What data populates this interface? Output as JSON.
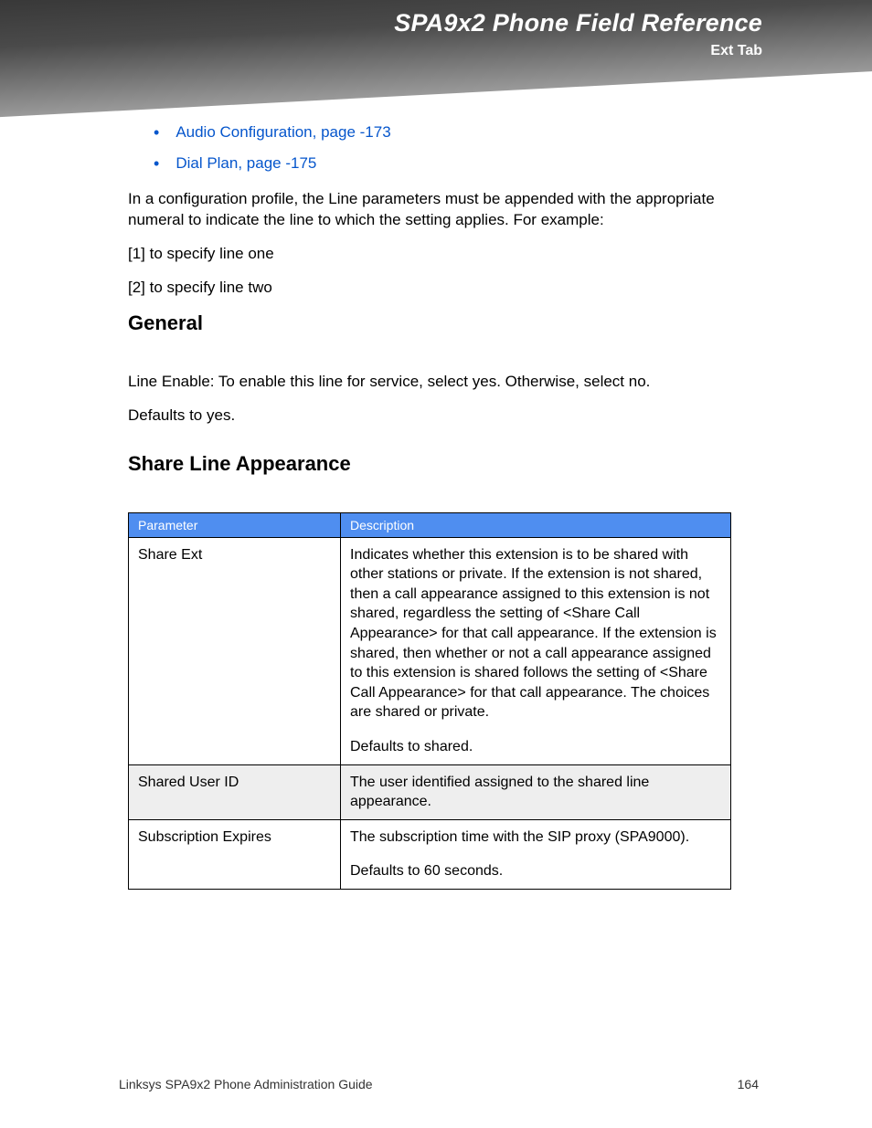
{
  "header": {
    "title": "SPA9x2 Phone Field Reference",
    "subtitle": "Ext Tab"
  },
  "links": [
    "Audio Configuration, page -173",
    "Dial Plan, page -175"
  ],
  "intro": "In a configuration profile, the Line parameters must be appended with the appropriate numeral to indicate the line to which the setting applies. For example:",
  "examples": [
    "[1] to specify line one",
    "[2] to specify line two"
  ],
  "section_general": {
    "heading": "General",
    "p1": "Line Enable: To enable this line for service, select yes. Otherwise, select no.",
    "p2": "Defaults to yes."
  },
  "section_sla": {
    "heading": "Share Line Appearance",
    "columns": {
      "param": "Parameter",
      "desc": "Description"
    },
    "rows": [
      {
        "param": "Share Ext",
        "desc": "Indicates whether this extension is to be shared with other stations or private. If the extension is not shared, then a call appearance assigned to this extension is not shared, regardless the setting of <Share Call Appearance> for that call appearance. If the extension is shared, then whether or not a call appearance assigned to this extension is shared follows the setting of <Share Call Appearance> for that call appearance. The choices are shared or private.",
        "extra": "Defaults to shared."
      },
      {
        "param": "Shared User ID",
        "desc": "The user identified assigned to the shared line appearance.",
        "extra": ""
      },
      {
        "param": "Subscription Expires",
        "desc": "The subscription time with the SIP proxy (SPA9000).",
        "extra": "Defaults to 60 seconds."
      }
    ]
  },
  "footer": {
    "left": "Linksys SPA9x2 Phone Administration Guide",
    "right": "164"
  }
}
